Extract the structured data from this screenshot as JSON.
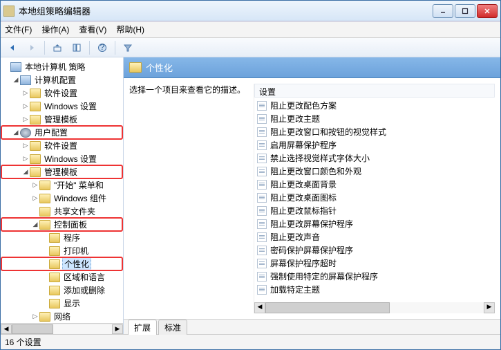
{
  "window": {
    "title": "本地组策略编辑器"
  },
  "menu": {
    "file": "文件(F)",
    "action": "操作(A)",
    "view": "查看(V)",
    "help": "帮助(H)"
  },
  "tree": {
    "root": "本地计算机 策略",
    "computer_config": "计算机配置",
    "cc_software": "软件设置",
    "cc_windows": "Windows 设置",
    "cc_admin": "管理模板",
    "user_config": "用户配置",
    "uc_software": "软件设置",
    "uc_windows": "Windows 设置",
    "uc_admin": "管理模板",
    "start_menu": "\"开始\" 菜单和",
    "win_components": "Windows 组件",
    "shared_folders": "共享文件夹",
    "control_panel": "控制面板",
    "programs": "程序",
    "printers": "打印机",
    "personalization": "个性化",
    "region_lang": "区域和语言",
    "add_remove": "添加或删除",
    "display": "显示",
    "network": "网络"
  },
  "details": {
    "heading": "个性化",
    "hint": "选择一个项目来查看它的描述。",
    "column_header": "设置",
    "items": [
      "阻止更改配色方案",
      "阻止更改主题",
      "阻止更改窗口和按钮的视觉样式",
      "启用屏幕保护程序",
      "禁止选择视觉样式字体大小",
      "阻止更改窗口颜色和外观",
      "阻止更改桌面背景",
      "阻止更改桌面图标",
      "阻止更改鼠标指针",
      "阻止更改屏幕保护程序",
      "阻止更改声音",
      "密码保护屏幕保护程序",
      "屏幕保护程序超时",
      "强制使用特定的屏幕保护程序",
      "加载特定主题"
    ],
    "tab_extended": "扩展",
    "tab_standard": "标准"
  },
  "status": {
    "text": "16 个设置"
  }
}
